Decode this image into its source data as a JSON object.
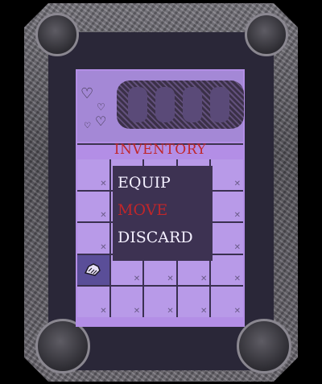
{
  "inventory": {
    "title": "INVENTORY",
    "slots_total": 25,
    "equipped_slot_index": 15,
    "item_icon": "shoe-icon"
  },
  "context_menu": {
    "items": [
      {
        "label": "EQUIP",
        "selected": false
      },
      {
        "label": "MOVE",
        "selected": true
      },
      {
        "label": "DISCARD",
        "selected": false
      }
    ]
  },
  "colors": {
    "panel": "#b38ee6",
    "menu_bg": "#3d3252",
    "accent_red": "#c0262a",
    "frame": "#6e6b73"
  },
  "decorations": {
    "hearts": "heart-icon"
  }
}
